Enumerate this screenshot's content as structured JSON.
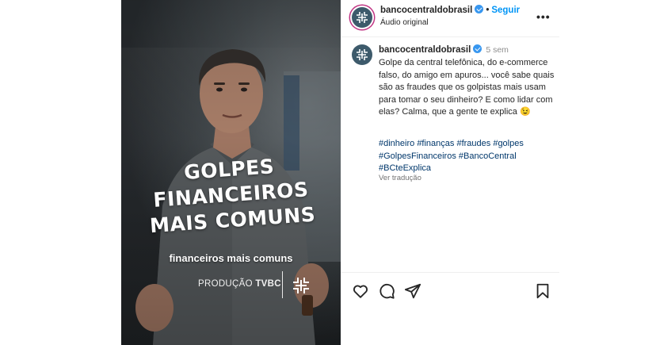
{
  "video": {
    "title_lines": [
      "GOLPES",
      "FINANCEIROS",
      "MAIS COMUNS"
    ],
    "caption": "financeiros mais comuns",
    "credit_prefix": "PRODUÇÃO ",
    "credit_brand": "TVBC"
  },
  "header": {
    "username": "bancocentraldobrasil",
    "dot": "•",
    "follow_label": "Seguir",
    "audio": "Áudio original",
    "more_icon": "more-options-icon"
  },
  "post": {
    "username": "bancocentraldobrasil",
    "time": "5 sem",
    "text": "Golpe da central telefônica, do e-commerce falso, do amigo em apuros... você sabe quais são as fraudes que os golpistas mais usam para tomar o seu dinheiro? E como lidar com elas? Calma, que a gente te explica 😉",
    "hashtags": "#dinheiro #finanças #fraudes #golpes #GolpesFinanceiros #BancoCentral #BCteExplica",
    "translate_label": "Ver tradução"
  },
  "actions": {
    "icons": [
      "heart-icon",
      "comment-icon",
      "share-icon",
      "bookmark-icon"
    ]
  },
  "colors": {
    "follow": "#0095f6",
    "hashtag": "#00376b",
    "verified": "#3897f0",
    "avatar_bg": "#3d5a6b"
  }
}
